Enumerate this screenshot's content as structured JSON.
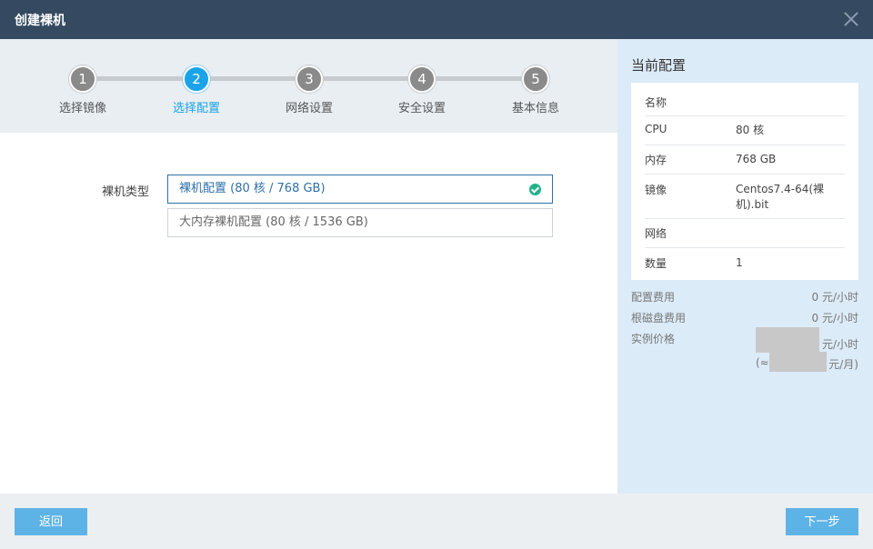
{
  "dialog": {
    "title": "创建裸机"
  },
  "steps": [
    {
      "num": "1",
      "label": "选择镜像"
    },
    {
      "num": "2",
      "label": "选择配置"
    },
    {
      "num": "3",
      "label": "网络设置"
    },
    {
      "num": "4",
      "label": "安全设置"
    },
    {
      "num": "5",
      "label": "基本信息"
    }
  ],
  "active_step": 2,
  "form": {
    "type_label": "裸机类型",
    "options": [
      {
        "label": "裸机配置 (80 核 / 768 GB)",
        "selected": true
      },
      {
        "label": "大内存裸机配置 (80 核 / 1536 GB)",
        "selected": false
      }
    ]
  },
  "sidebar": {
    "title": "当前配置",
    "rows": [
      {
        "key": "名称",
        "value": ""
      },
      {
        "key": "CPU",
        "value": "80 核"
      },
      {
        "key": "内存",
        "value": "768 GB"
      },
      {
        "key": "镜像",
        "value": "Centos7.4-64(裸机).bit"
      },
      {
        "key": "网络",
        "value": ""
      },
      {
        "key": "数量",
        "value": "1"
      }
    ],
    "fees": [
      {
        "key": "配置费用",
        "value": "0 元/小时"
      },
      {
        "key": "根磁盘费用",
        "value": "0 元/小时"
      }
    ],
    "price": {
      "key": "实例价格",
      "hour_unit": "元/小时",
      "month_prefix": "(≈",
      "month_unit": "元/月)"
    }
  },
  "footer": {
    "back_label": "返回",
    "next_label": "下一步"
  },
  "colors": {
    "titlebar": "#354a60",
    "accent": "#1aa3e8",
    "button": "#5eb3e6",
    "check": "#21b28a"
  }
}
